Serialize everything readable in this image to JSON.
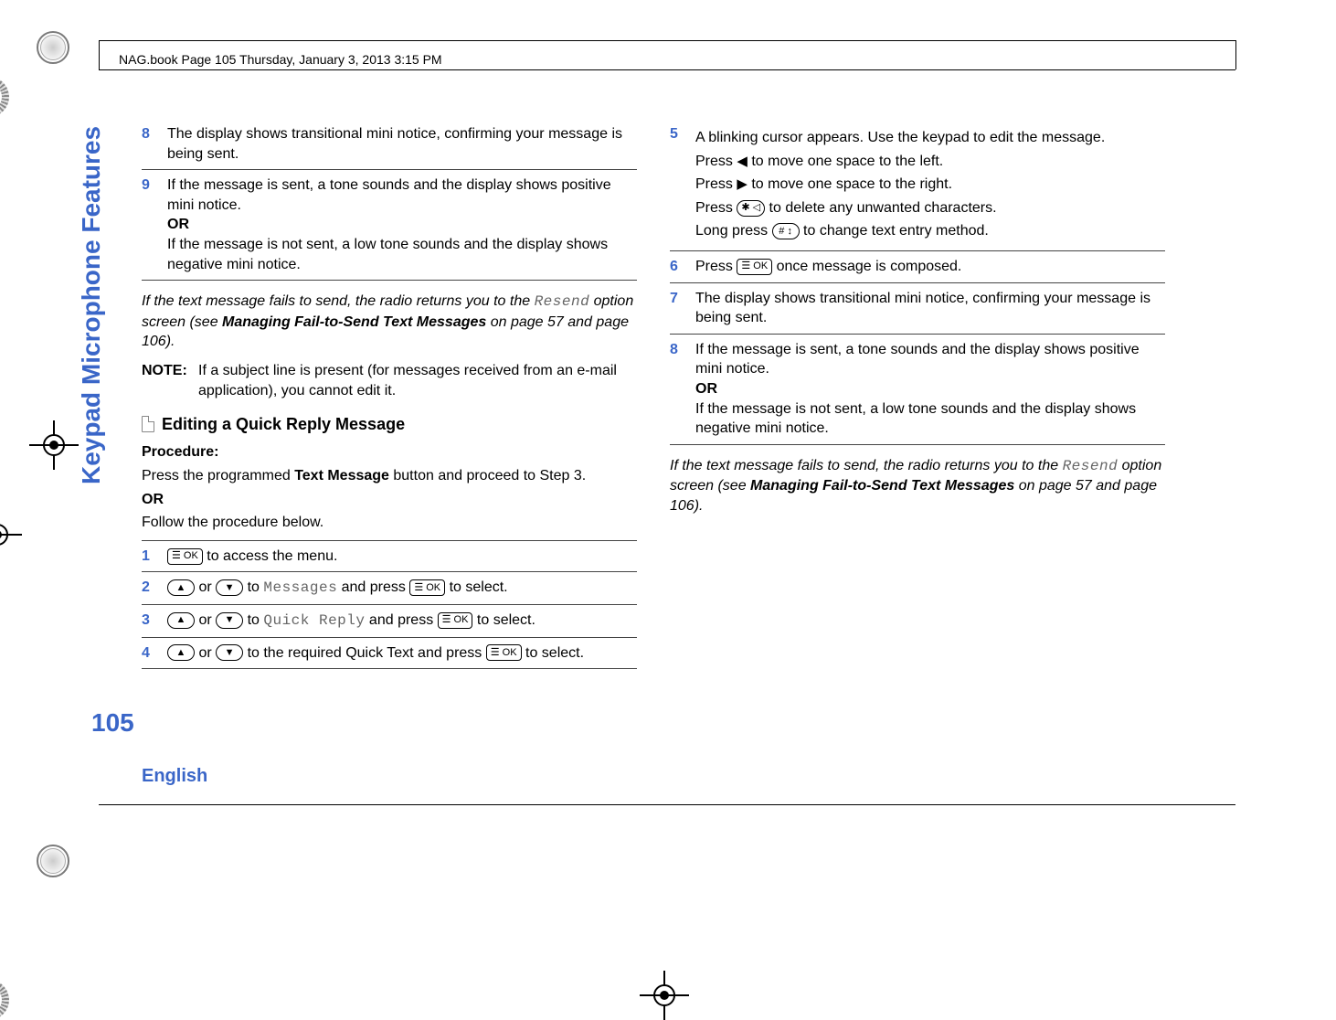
{
  "header": {
    "path_text": "NAG.book  Page 105  Thursday, January 3, 2013  3:15 PM"
  },
  "sidebar": {
    "section_title": "Keypad Microphone Features",
    "page_number": "105",
    "language": "English"
  },
  "keys": {
    "ok": "☰ OK",
    "up": "▲",
    "down": "▼",
    "star": "✱ ◁",
    "hash": "# ↕",
    "left": "◀",
    "right": "▶"
  },
  "left_col": {
    "step8": "The display shows transitional mini notice, confirming your message is being sent.",
    "step9_a": "If the message is sent, a tone sounds and the display shows positive mini notice.",
    "or": "OR",
    "step9_b": "If the message is not sent, a low tone sounds and the display shows negative mini notice.",
    "fail_a": "If the text message fails to send, the radio returns you to the ",
    "fail_mono": "Resend",
    "fail_b": " option screen (see ",
    "fail_bold": "Managing Fail-to-Send Text Messages",
    "fail_c": " on page 57 and page 106).",
    "note_label": "NOTE:",
    "note_text": "If a subject line is present (for messages received from an e-mail application), you cannot edit it.",
    "section_title": "Editing a Quick Reply Message",
    "procedure": "Procedure:",
    "proc_a": "Press the programmed ",
    "proc_bold": "Text Message",
    "proc_b": " button and proceed to Step 3.",
    "proc_or": "OR",
    "proc_c": "Follow the procedure below.",
    "s1_a": " to access the menu.",
    "s2_a": " or ",
    "s2_b": " to ",
    "s2_mono": "Messages",
    "s2_c": " and press ",
    "s2_d": " to select.",
    "s3_mono": "Quick Reply",
    "s4_a": " to the required Quick Text and press ",
    "s4_b": " to select."
  },
  "right_col": {
    "s5_a": "A blinking cursor appears. Use the keypad to edit the message.",
    "s5_b1": "Press ",
    "s5_b2": " to move one space to the left.",
    "s5_c2": " to move one space to the right.",
    "s5_d2": " to delete any unwanted characters.",
    "s5_e1": "Long press ",
    "s5_e2": " to change text entry method.",
    "s6_a": "Press ",
    "s6_b": " once message is composed.",
    "s7": "The display shows transitional mini notice, confirming your message is being sent.",
    "s8_a": "If the message is sent, a tone sounds and the display shows positive mini notice.",
    "or": "OR",
    "s8_b": "If the message is not sent, a low tone sounds and the display shows negative mini notice.",
    "fail_a": "If the text message fails to send, the radio returns you to the ",
    "fail_mono": "Resend",
    "fail_b": " option screen (see ",
    "fail_bold": "Managing Fail-to-Send Text Messages",
    "fail_c": " on page 57 and page 106)."
  }
}
